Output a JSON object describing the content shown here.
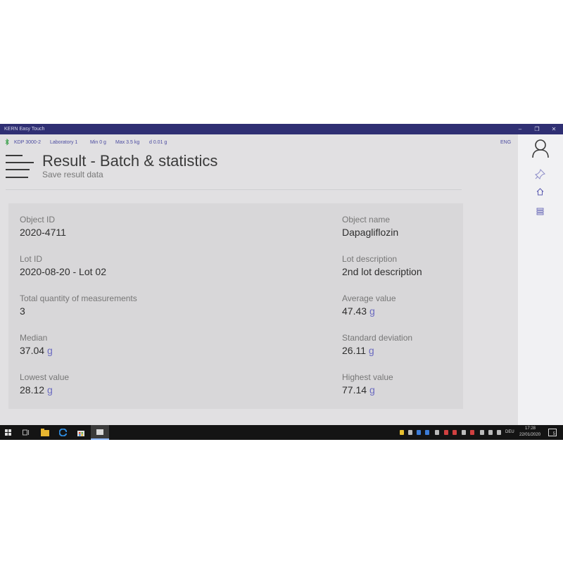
{
  "window": {
    "title": "KERN Easy Touch",
    "minimize_glyph": "–",
    "maximize_glyph": "❐",
    "close_glyph": "✕"
  },
  "statusbar": {
    "device": "KDP 3000-2",
    "location": "Laboratory 1",
    "min": "Min 0 g",
    "max": "Max 3.5 kg",
    "d": "d 0.01 g",
    "language": "ENG"
  },
  "header": {
    "title": "Result - Batch & statistics",
    "subtitle": "Save result data"
  },
  "result": {
    "left": [
      {
        "label": "Object ID",
        "value": "2020-4711",
        "unit": ""
      },
      {
        "label": "Lot ID",
        "value": "2020-08-20 - Lot 02",
        "unit": ""
      },
      {
        "label": "Total quantity of measurements",
        "value": "3",
        "unit": ""
      },
      {
        "label": "Median",
        "value": "37.04",
        "unit": "g"
      },
      {
        "label": "Lowest value",
        "value": "28.12",
        "unit": "g"
      }
    ],
    "right": [
      {
        "label": "Object name",
        "value": "Dapagliflozin",
        "unit": ""
      },
      {
        "label": "Lot description",
        "value": "2nd lot description",
        "unit": ""
      },
      {
        "label": "Average value",
        "value": "47.43",
        "unit": "g"
      },
      {
        "label": "Standard deviation",
        "value": "26.11",
        "unit": "g"
      },
      {
        "label": "Highest value",
        "value": "77.14",
        "unit": "g"
      }
    ]
  },
  "sidebar": {
    "icons": [
      "user-icon",
      "pin-icon",
      "home-icon",
      "grid-icon"
    ]
  },
  "taskbar": {
    "language": "DEU",
    "time": "17:28",
    "date": "22/01/2020",
    "notification_count": "5"
  },
  "colors": {
    "titlebar": "#2f2f73",
    "accent": "#4b4ba0",
    "unit": "#6a6ac0",
    "taskbar": "#141414"
  }
}
